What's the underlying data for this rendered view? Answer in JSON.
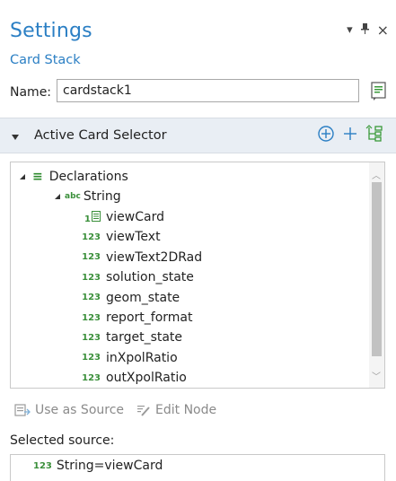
{
  "panel": {
    "title": "Settings",
    "subtitle": "Card Stack",
    "controls": {
      "dropdown": "▾",
      "pin": "⊥",
      "close": "×"
    }
  },
  "name_field": {
    "label": "Name:",
    "value": "cardstack1"
  },
  "section": {
    "title": "Active Card Selector"
  },
  "tree": {
    "root": "Declarations",
    "child": {
      "type_badge": "abc",
      "label": "String"
    },
    "items": [
      {
        "icon": "1",
        "label": "viewCard"
      },
      {
        "icon": "123",
        "label": "viewText"
      },
      {
        "icon": "123",
        "label": "viewText2DRad"
      },
      {
        "icon": "123",
        "label": "solution_state"
      },
      {
        "icon": "123",
        "label": "geom_state"
      },
      {
        "icon": "123",
        "label": "report_format"
      },
      {
        "icon": "123",
        "label": "target_state"
      },
      {
        "icon": "123",
        "label": "inXpolRatio"
      },
      {
        "icon": "123",
        "label": "outXpolRatio"
      }
    ]
  },
  "toolbar": {
    "use_as_source": "Use as Source",
    "edit_node": "Edit Node"
  },
  "selected_source": {
    "label": "Selected source:",
    "item": {
      "icon": "123",
      "label": "String=viewCard"
    }
  }
}
